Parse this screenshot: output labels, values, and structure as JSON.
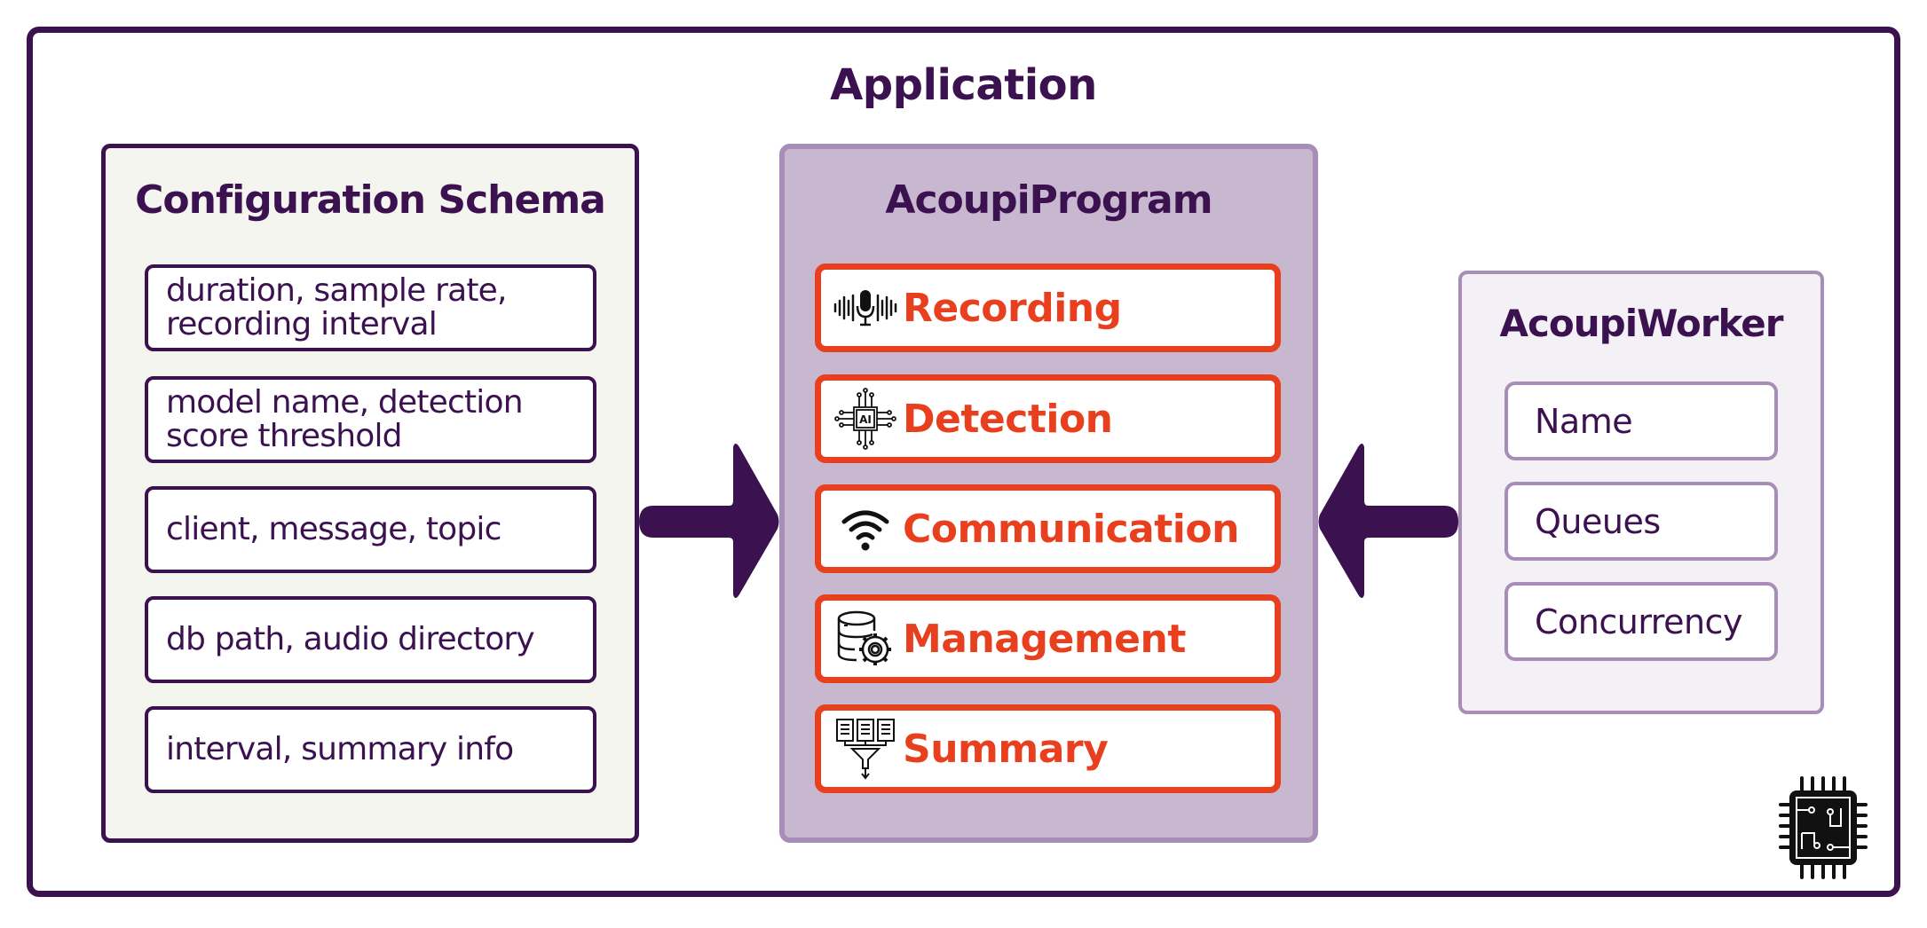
{
  "application": {
    "title": "Application"
  },
  "config_schema": {
    "title": "Configuration Schema",
    "items": [
      {
        "line1": "duration, sample rate,",
        "line2": "recording interval"
      },
      {
        "line1": "model name, detection",
        "line2": "score threshold"
      },
      {
        "line1": "client, message, topic",
        "line2": ""
      },
      {
        "line1": "db path, audio directory",
        "line2": ""
      },
      {
        "line1": "interval, summary info",
        "line2": ""
      }
    ]
  },
  "program": {
    "title": "AcoupiProgram",
    "items": [
      {
        "label": "Recording",
        "icon": "microphone-waveform-icon"
      },
      {
        "label": "Detection",
        "icon": "ai-chip-icon"
      },
      {
        "label": "Communication",
        "icon": "wifi-icon"
      },
      {
        "label": "Management",
        "icon": "database-gear-icon"
      },
      {
        "label": "Summary",
        "icon": "documents-funnel-icon"
      }
    ]
  },
  "worker": {
    "title": "AcoupiWorker",
    "items": [
      "Name",
      "Queues",
      "Concurrency"
    ]
  },
  "colors": {
    "primary": "#3b1150",
    "accent": "#e8401e",
    "program_fill": "#c8b8cf",
    "program_border": "#a88db8",
    "config_fill": "#f5f5f0",
    "worker_fill": "#f3f1f5"
  }
}
